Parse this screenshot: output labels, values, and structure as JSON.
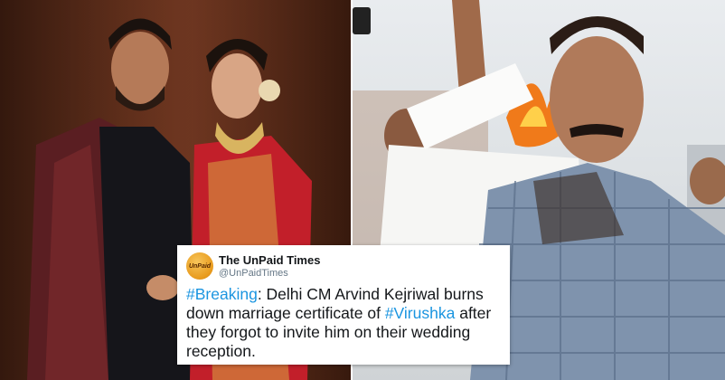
{
  "tweet": {
    "account_name": "The UnPaid Times",
    "account_handle": "@UnPaidTimes",
    "avatar_text": "UnPaid",
    "hashtag_1": "#Breaking",
    "text_1": ": Delhi CM Arvind Kejriwal burns down marriage certificate of ",
    "hashtag_2": "#Virushka",
    "text_2": " after they forgot to invite him on their wedding reception."
  },
  "colors": {
    "hashtag": "#1b95e0",
    "name": "#14171a",
    "handle": "#657786"
  }
}
